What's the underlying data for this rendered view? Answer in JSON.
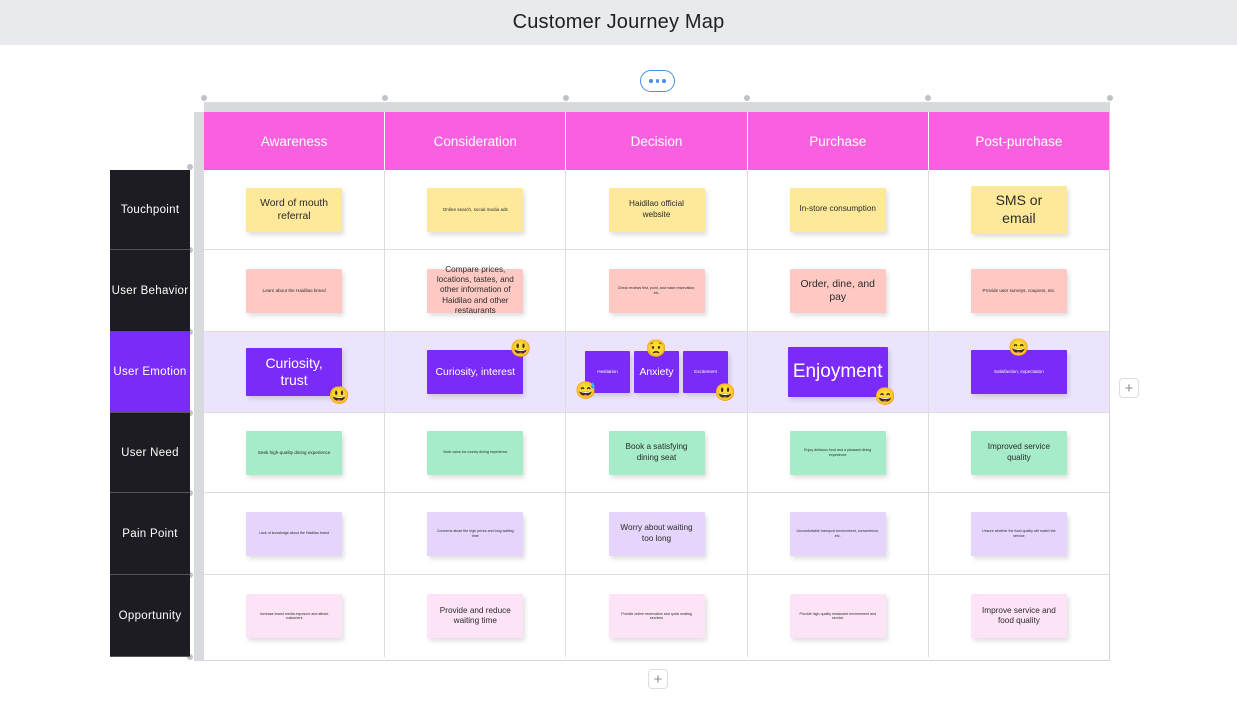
{
  "titlebar": {
    "title": "Customer Journey Map"
  },
  "toolbar": {
    "more_label": "more-options"
  },
  "controls": {
    "add_column_label": "+",
    "add_row_label": "+"
  },
  "columns": [
    {
      "label": "Awareness"
    },
    {
      "label": "Consideration"
    },
    {
      "label": "Decision"
    },
    {
      "label": "Purchase"
    },
    {
      "label": "Post-purchase"
    }
  ],
  "rows": [
    {
      "label": "Touchpoint",
      "color": "yellow",
      "active": false,
      "cells": [
        {
          "notes": [
            {
              "text": "Word of mouth referral",
              "size": "md"
            }
          ]
        },
        {
          "notes": [
            {
              "text": "Online search, social media ads",
              "size": "xs"
            }
          ]
        },
        {
          "notes": [
            {
              "text": "Haidilao official website",
              "size": "sm"
            }
          ]
        },
        {
          "notes": [
            {
              "text": "In-store consumption",
              "size": "sm"
            }
          ]
        },
        {
          "notes": [
            {
              "text": "SMS  or email",
              "size": "lg"
            }
          ]
        }
      ]
    },
    {
      "label": "User  Behavior",
      "color": "pink",
      "active": false,
      "cells": [
        {
          "notes": [
            {
              "text": "Learn about the Haidilao brand",
              "size": "xs"
            }
          ]
        },
        {
          "notes": [
            {
              "text": "Compare prices, locations, tastes, and other information of Haidilao and other restaurants",
              "size": "sm"
            }
          ]
        },
        {
          "notes": [
            {
              "text": "Check reviews first, point, and make reservation, etc.",
              "size": "xxs"
            }
          ]
        },
        {
          "notes": [
            {
              "text": "Order, dine, and pay",
              "size": "md"
            }
          ]
        },
        {
          "notes": [
            {
              "text": "Provide  user surveys, coupons, etc.",
              "size": "xs"
            }
          ]
        }
      ]
    },
    {
      "label": "User  Emotion",
      "color": "purple",
      "active": true,
      "cells": [
        {
          "notes": [
            {
              "text": "Curiosity, trust",
              "size": "lg",
              "emoji": "😃",
              "emoji_pos": "br"
            }
          ]
        },
        {
          "notes": [
            {
              "text": "Curiosity, interest",
              "size": "md",
              "emoji": "😃",
              "emoji_pos": "tr"
            }
          ]
        },
        {
          "notes": [
            {
              "text": "Hesitation",
              "size": "xs",
              "emoji": "😅",
              "emoji_pos": "bl"
            },
            {
              "text": "Anxiety",
              "size": "md",
              "emoji": "😟",
              "emoji_pos": "tc"
            },
            {
              "text": "Excitement",
              "size": "xs",
              "emoji": "😃",
              "emoji_pos": "br"
            }
          ]
        },
        {
          "notes": [
            {
              "text": "Enjoyment",
              "size": "xl",
              "emoji": "😄",
              "emoji_pos": "br"
            }
          ]
        },
        {
          "notes": [
            {
              "text": "Satisfaction, expectation",
              "size": "xs",
              "emoji": "😄",
              "emoji_pos": "tc"
            }
          ]
        }
      ]
    },
    {
      "label": "User  Need",
      "color": "green",
      "active": false,
      "cells": [
        {
          "notes": [
            {
              "text": "Seek high-quality dining experience",
              "size": "xs"
            }
          ]
        },
        {
          "notes": [
            {
              "text": "Seek value-for-money dining experience",
              "size": "xxs"
            }
          ]
        },
        {
          "notes": [
            {
              "text": "Book a satisfying dining seat",
              "size": "sm"
            }
          ]
        },
        {
          "notes": [
            {
              "text": "Enjoy delicious food and a pleasant dining experience",
              "size": "xxs"
            }
          ]
        },
        {
          "notes": [
            {
              "text": "Improved service quality",
              "size": "sm"
            }
          ]
        }
      ]
    },
    {
      "label": "Pain  Point",
      "color": "lilac",
      "active": false,
      "cells": [
        {
          "notes": [
            {
              "text": "Lack of knowledge about the Haidilao brand",
              "size": "xxs"
            }
          ]
        },
        {
          "notes": [
            {
              "text": "Concerns about the high prices and long waiting time",
              "size": "xxs"
            }
          ]
        },
        {
          "notes": [
            {
              "text": "Worry about waiting too long",
              "size": "sm"
            }
          ]
        },
        {
          "notes": [
            {
              "text": "Uncomfortable transport environment, convenience, etc.",
              "size": "xxs"
            }
          ]
        },
        {
          "notes": [
            {
              "text": "Unsure whether the food quality will match the service",
              "size": "xxs"
            }
          ]
        }
      ]
    },
    {
      "label": "Opportunity",
      "color": "lightpink",
      "active": false,
      "cells": [
        {
          "notes": [
            {
              "text": "Increase brand media exposure and attract customers",
              "size": "xxs"
            }
          ]
        },
        {
          "notes": [
            {
              "text": "Provide and reduce waiting time",
              "size": "sm"
            }
          ]
        },
        {
          "notes": [
            {
              "text": "Provide online reservation and quick seating services",
              "size": "xxs"
            }
          ]
        },
        {
          "notes": [
            {
              "text": "Provide high-quality restaurant environment and service",
              "size": "xxs"
            }
          ]
        },
        {
          "notes": [
            {
              "text": "Improve service and food quality",
              "size": "sm"
            }
          ]
        }
      ]
    }
  ]
}
